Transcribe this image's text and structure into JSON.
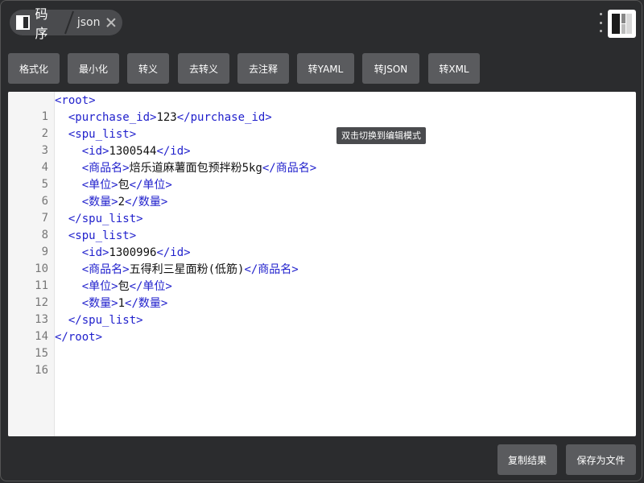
{
  "app": {
    "name": "码序",
    "tab": "json"
  },
  "toolbar": {
    "buttons": [
      "格式化",
      "最小化",
      "转义",
      "去转义",
      "去注释",
      "转YAML",
      "转JSON",
      "转XML"
    ]
  },
  "editor": {
    "line_numbers": [
      "1",
      "2",
      "3",
      "4",
      "5",
      "6",
      "7",
      "8",
      "9",
      "10",
      "11",
      "12",
      "13",
      "14",
      "15",
      "16"
    ],
    "lines": [
      {
        "indent": "",
        "open": "<root>",
        "text": "",
        "close": ""
      },
      {
        "indent": "  ",
        "open": "<purchase_id>",
        "text": "123",
        "close": "</purchase_id>"
      },
      {
        "indent": "  ",
        "open": "<spu_list>",
        "text": "",
        "close": ""
      },
      {
        "indent": "    ",
        "open": "<id>",
        "text": "1300544",
        "close": "</id>"
      },
      {
        "indent": "    ",
        "open": "<商品名>",
        "text": "焙乐道麻薯面包预拌粉5kg",
        "close": "</商品名>"
      },
      {
        "indent": "    ",
        "open": "<单位>",
        "text": "包",
        "close": "</单位>"
      },
      {
        "indent": "    ",
        "open": "<数量>",
        "text": "2",
        "close": "</数量>"
      },
      {
        "indent": "  ",
        "open": "</spu_list>",
        "text": "",
        "close": ""
      },
      {
        "indent": "  ",
        "open": "<spu_list>",
        "text": "",
        "close": ""
      },
      {
        "indent": "    ",
        "open": "<id>",
        "text": "1300996",
        "close": "</id>"
      },
      {
        "indent": "    ",
        "open": "<商品名>",
        "text": "五得利三星面粉(低筋)",
        "close": "</商品名>"
      },
      {
        "indent": "    ",
        "open": "<单位>",
        "text": "包",
        "close": "</单位>"
      },
      {
        "indent": "    ",
        "open": "<数量>",
        "text": "1",
        "close": "</数量>"
      },
      {
        "indent": "  ",
        "open": "</spu_list>",
        "text": "",
        "close": ""
      },
      {
        "indent": "",
        "open": "</root>",
        "text": "",
        "close": ""
      }
    ],
    "tooltip": "双击切换到编辑模式"
  },
  "footer": {
    "copy": "复制结果",
    "save": "保存为文件"
  },
  "icons": {
    "logo": "app-logo-icon",
    "close": "close-icon",
    "menu": "kebab-menu-icon"
  }
}
